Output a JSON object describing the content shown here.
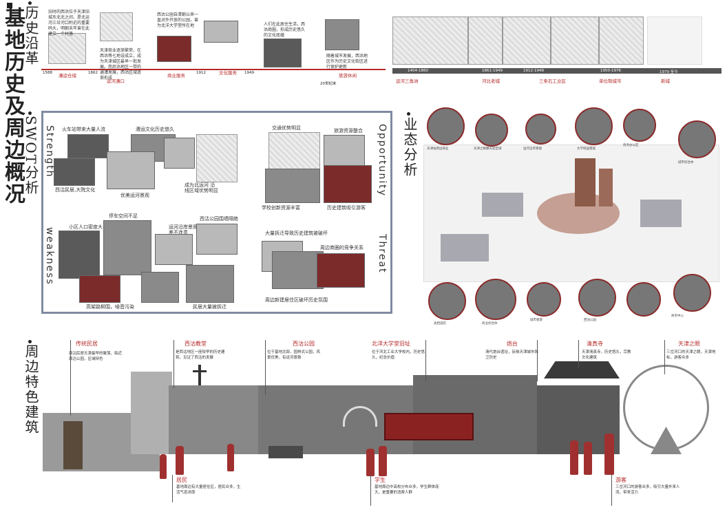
{
  "main_title": "基地历史及周边概况",
  "sections": {
    "history": "历史沿革",
    "swot": "SWOT分析",
    "business": "业态分析",
    "features": "周边特色建筑"
  },
  "history": {
    "years": [
      "1588",
      "1862",
      "1912",
      "1949",
      "20世纪末"
    ],
    "labels": [
      "漕运仓储",
      "运河漕口",
      "商业服务",
      "文化服务",
      "旅游休闲"
    ],
    "captions": [
      "旧时的西沽位于天津旧城东北北之间，是北运河三岔河口附近的重要码头，明朝末年曾在此建立一个村落",
      "天津商业逐渐繁荣，在西沽等七地设成立，成为天津城区最早一批发展。而后沽地区一带的通漕发展，西沽区域逐渐形成",
      "西沽公园自清朝以来一直对外开放的公园，曾为北洋大学堂所在地",
      "人们在此居住生活，西沽商圈，形成历史悠久的文化底蕴",
      "随着城市发展，西沽地区作为历史文化街区进行保护更新"
    ],
    "map_periods": [
      "1404-1860",
      "1861-1949",
      "1912-1949",
      "1950-1976",
      "1979 至今"
    ],
    "map_period_labels": [
      "运河三角洲",
      "河北老城",
      "三条石工业区",
      "单位制城市",
      "新城"
    ]
  },
  "swot": {
    "strength": "Strength",
    "weakness": "weakness",
    "opportunity": "Opportunity",
    "threat": "Threat",
    "s_items": [
      "火车站带来大量人流",
      "漕运文化历史悠久",
      "西沽民居,大院文化",
      "优美运河景观",
      "成为北运河 沿线区域优势明显"
    ],
    "w_items": [
      "小区人口密度大",
      "停车空间不足",
      "运河沿岸景观较差不连贯",
      "西沽公园围墙隔绝",
      "高架路柳围，噪音污染",
      "民居大量被拆迁"
    ],
    "o_items": [
      "交通优势明显",
      "旅游资源整合",
      "学校创新资源丰富",
      "历史建筑吸引游客"
    ],
    "t_items": [
      "大量拆迁导致历史建筑被破坏",
      "周边商圈的竞争关系",
      "周边新建居住区破坏历史氛围"
    ]
  },
  "business": {
    "captions_top": [
      "天津站周边商业",
      "天津之眼摩天轮区域",
      "运河沿岸景观",
      "大学校园景观",
      "商务办公区",
      "城市综合体"
    ],
    "captions_bottom": [
      "高档酒店",
      "商业综合体",
      "城市夜景",
      "西沽公园",
      "商务中心"
    ]
  },
  "features": {
    "items": [
      {
        "title": "传统民居",
        "desc": "西沽民居天津最早的聚落，临近西沽公园，区域特色"
      },
      {
        "title": "西沽教堂",
        "desc": "是西沽地区一座较早的历史建筑，见证了西沽的发展"
      },
      {
        "title": "西沽公园",
        "desc": "位于基地北部，园林式公园，风景优美，有运河景致"
      },
      {
        "title": "北洋大学堂旧址",
        "desc": "位于河北工业大学校内，历史悠久，纪念价值"
      },
      {
        "title": "炮台",
        "desc": "清代炮台遗址，反映天津城市防卫历史"
      },
      {
        "title": "清真寺",
        "desc": "天津清真寺，历史悠久，宗教文化建筑"
      },
      {
        "title": "天津之眼",
        "desc": "三岔河口的天津之眼，天津地标，游客众多"
      }
    ],
    "people": [
      {
        "title": "居民",
        "desc": "基地周边有大量居住区，居民众多，生活气息浓厚"
      },
      {
        "title": "学生",
        "desc": "基地周边中高校分布众多，学生群体庞大，是重要的消费人群"
      },
      {
        "title": "游客",
        "desc": "三岔河口的游客众多，吸引大量外来人流，带来活力"
      }
    ]
  },
  "colors": {
    "accent": "#b52a2a",
    "swot_border": "#7f8aa0"
  }
}
